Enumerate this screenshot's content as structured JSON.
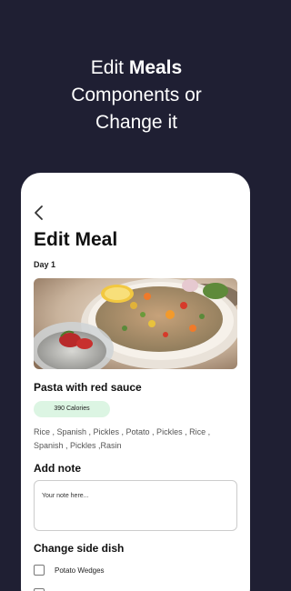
{
  "headline": {
    "line1_prefix": "Edit ",
    "line1_bold": "Meals",
    "line2": "Components or",
    "line3": "Change it"
  },
  "screen": {
    "title": "Edit Meal",
    "day": "Day 1",
    "meal": {
      "name": "Pasta with red sauce",
      "calories": "390 Calories",
      "ingredients": "Rice , Spanish , Pickles , Potato , Pickles , Rice , Spanish , Pickles ,Rasin"
    },
    "note": {
      "label": "Add note",
      "placeholder": "Your note here..."
    },
    "side_dish": {
      "label": "Change side dish",
      "options": [
        "Potato Wedges",
        ""
      ]
    }
  },
  "colors": {
    "background": "#1f1f33",
    "card": "#ffffff",
    "calorie_badge": "#dcf5e3"
  },
  "icons": {
    "back": "chevron-left-icon",
    "checkbox": "checkbox-icon"
  }
}
